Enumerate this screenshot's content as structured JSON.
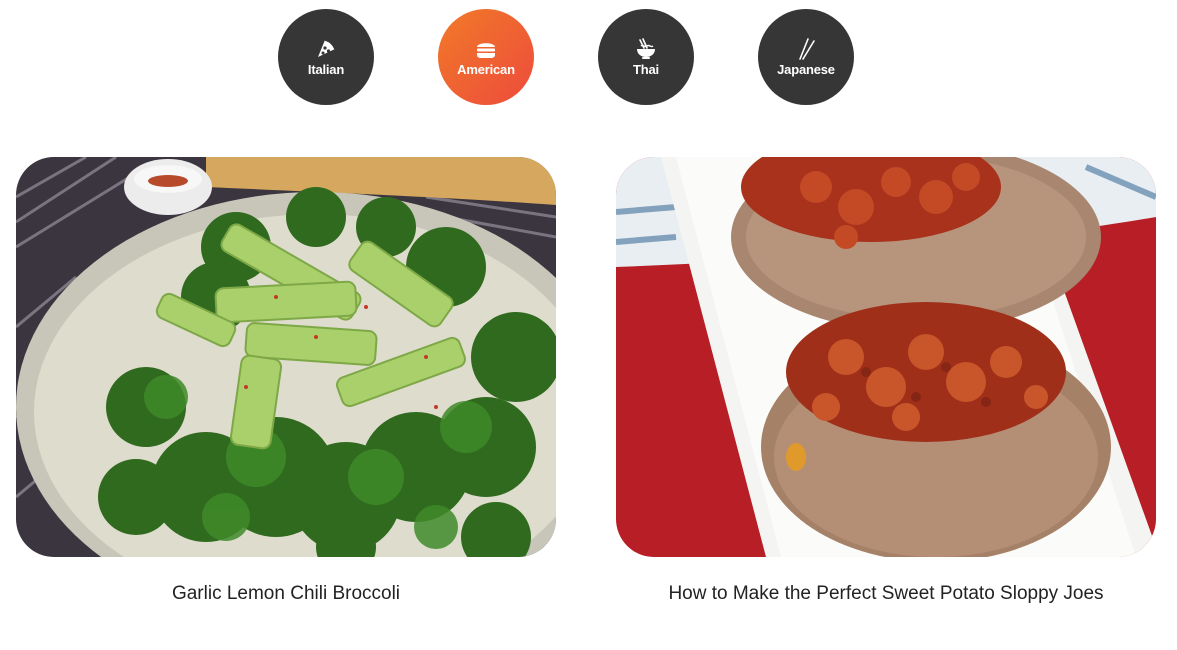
{
  "categories": [
    {
      "label": "Italian",
      "icon": "pizza-icon",
      "active": false
    },
    {
      "label": "American",
      "icon": "burger-icon",
      "active": true
    },
    {
      "label": "Thai",
      "icon": "noodles-icon",
      "active": false
    },
    {
      "label": "Japanese",
      "icon": "chopsticks-icon",
      "active": false
    }
  ],
  "recipes": [
    {
      "title": "Garlic Lemon Chili Broccoli",
      "image": "broccoli-photo"
    },
    {
      "title": "How to Make the Perfect Sweet Potato Sloppy Joes",
      "image": "sweet-potato-photo"
    }
  ],
  "colors": {
    "category_bg": "#363636",
    "active_gradient_start": "#f07a28",
    "active_gradient_end": "#ee4b3c",
    "title_text": "#222222"
  }
}
